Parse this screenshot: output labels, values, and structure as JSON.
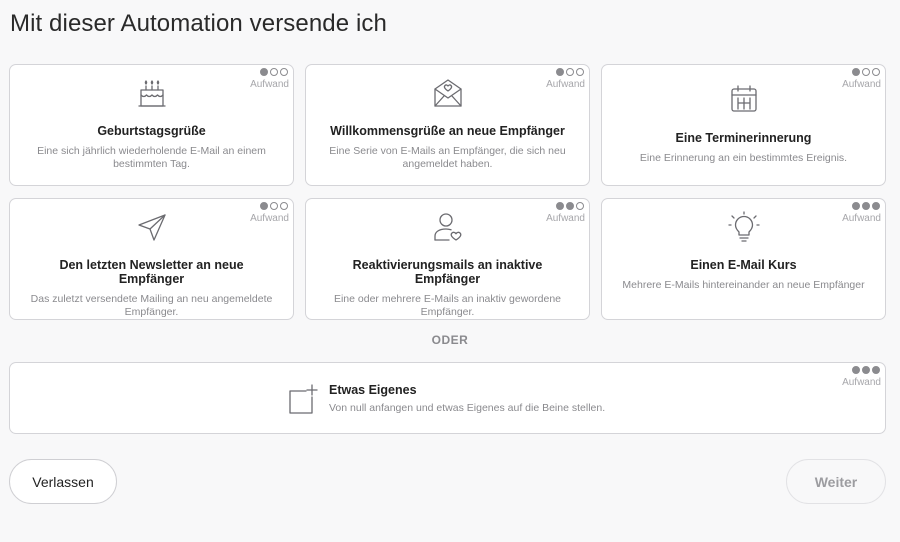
{
  "page": {
    "title": "Mit dieser Automation versende ich"
  },
  "effort_label": "Aufwand",
  "cards": [
    {
      "title": "Geburtstagsgrüße",
      "desc": "Eine sich jährlich wiederholende E-Mail an einem bestimmten Tag.",
      "effort": 1,
      "icon": "birthday-cake-icon"
    },
    {
      "title": "Willkommensgrüße an neue Empfänger",
      "desc": "Eine Serie von E-Mails an Empfänger, die sich neu angemeldet haben.",
      "effort": 1,
      "icon": "envelope-heart-icon"
    },
    {
      "title": "Eine Terminerinnerung",
      "desc": "Eine Erinnerung an ein bestimmtes Ereignis.",
      "effort": 1,
      "icon": "calendar-icon"
    },
    {
      "title": "Den letzten Newsletter an neue Empfänger",
      "desc": "Das zuletzt versendete Mailing an neu angemeldete Empfänger.",
      "effort": 1,
      "icon": "paper-plane-icon"
    },
    {
      "title": "Reaktivierungsmails an inaktive Empfänger",
      "desc": "Eine oder mehrere E-Mails an inaktiv gewordene Empfänger.",
      "effort": 2,
      "icon": "user-heart-icon"
    },
    {
      "title": "Einen E-Mail Kurs",
      "desc": "Mehrere E-Mails hintereinander an neue Empfänger",
      "effort": 3,
      "icon": "lightbulb-icon"
    }
  ],
  "separator": "ODER",
  "custom": {
    "title": "Etwas Eigenes",
    "desc": "Von null anfangen und etwas Eigenes auf die Beine stellen.",
    "effort": 3,
    "icon": "add-square-icon"
  },
  "buttons": {
    "leave": "Verlassen",
    "next": "Weiter"
  }
}
